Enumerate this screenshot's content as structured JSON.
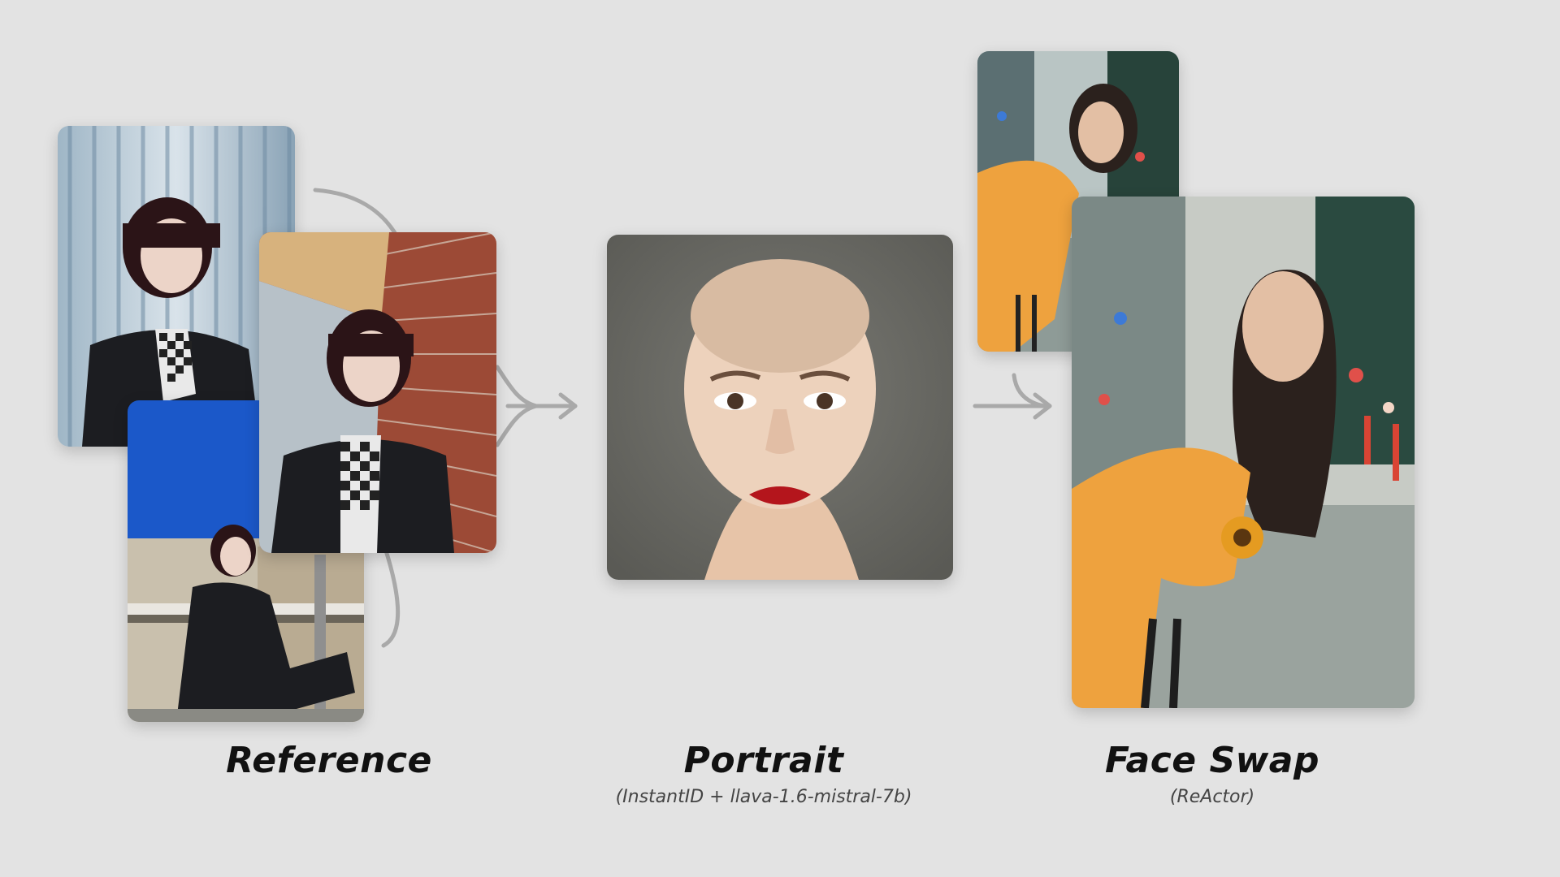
{
  "stages": [
    {
      "title": "Reference",
      "subtitle": ""
    },
    {
      "title": "Portrait",
      "subtitle": "(InstantID + llava-1.6-mistral-7b)"
    },
    {
      "title": "Face Swap",
      "subtitle": "(ReActor)"
    }
  ],
  "colors": {
    "background": "#e3e3e3",
    "connector": "#a9a9a9",
    "portrait_bg": "#6b6b66",
    "reference_blue": "#1b58c9",
    "brick": "#9c4a36",
    "raincoat": "#eea23e"
  }
}
